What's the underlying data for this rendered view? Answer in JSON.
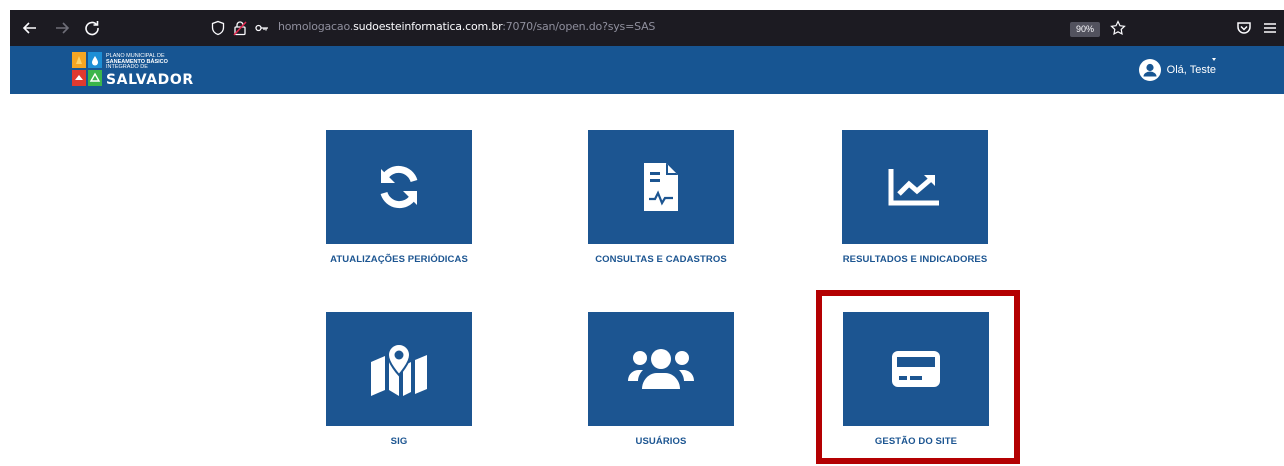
{
  "browser": {
    "url_prefix": "homologacao.",
    "url_host": "sudoesteinformatica.com.br",
    "url_suffix": ":7070/san/open.do?sys=SAS",
    "zoom": "90%"
  },
  "header": {
    "logo": {
      "line1": "PLANO MUNICIPAL DE",
      "line2": "SANEAMENTO BÁSICO",
      "line3": "INTEGRADO DE",
      "city": "SALVADOR"
    },
    "greeting": "Olá, Teste"
  },
  "tiles": [
    {
      "label": "ATUALIZAÇÕES PERIÓDICAS",
      "icon": "sync-icon"
    },
    {
      "label": "CONSULTAS E CADASTROS",
      "icon": "document-signature-icon"
    },
    {
      "label": "RESULTADOS E INDICADORES",
      "icon": "chart-line-icon"
    },
    {
      "label": "SIG",
      "icon": "map-marker-icon"
    },
    {
      "label": "USUÁRIOS",
      "icon": "users-icon"
    },
    {
      "label": "GESTÃO DO SITE",
      "icon": "credit-card-icon"
    }
  ],
  "colors": {
    "tile": "#1c5591",
    "header": "#175592",
    "highlight": "#b40002"
  }
}
